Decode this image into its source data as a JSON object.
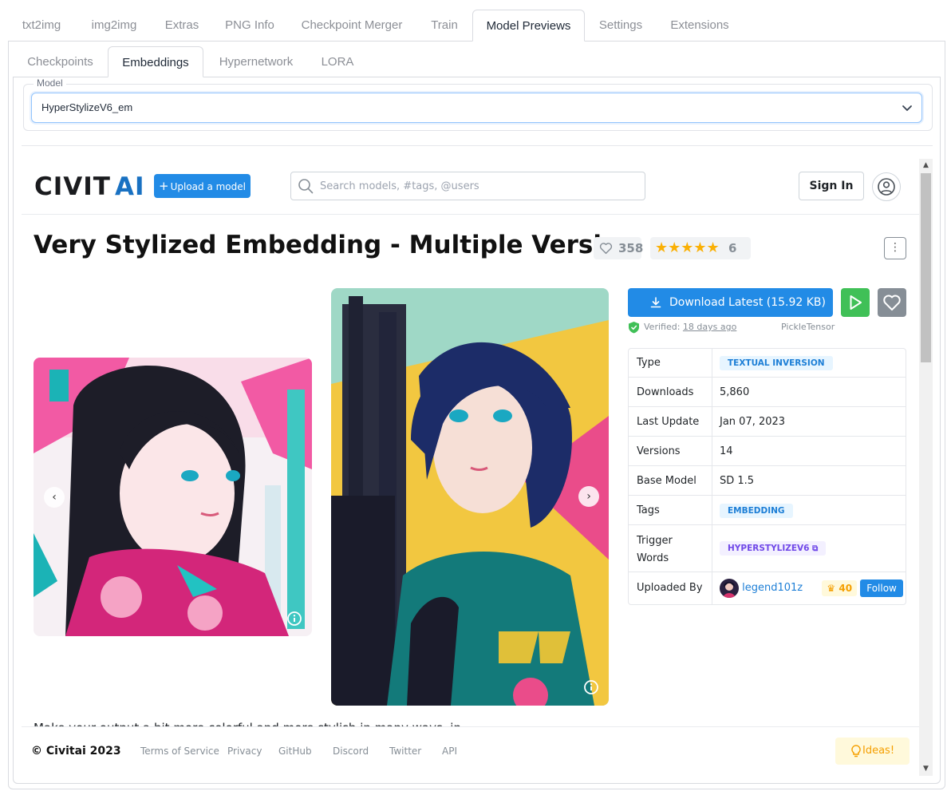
{
  "top_tabs": [
    {
      "label": "txt2img",
      "active": false
    },
    {
      "label": "img2img",
      "active": false
    },
    {
      "label": "Extras",
      "active": false
    },
    {
      "label": "PNG Info",
      "active": false
    },
    {
      "label": "Checkpoint Merger",
      "active": false
    },
    {
      "label": "Train",
      "active": false
    },
    {
      "label": "Model Previews",
      "active": true
    },
    {
      "label": "Settings",
      "active": false
    },
    {
      "label": "Extensions",
      "active": false
    }
  ],
  "sub_tabs": [
    {
      "label": "Checkpoints",
      "active": false
    },
    {
      "label": "Embeddings",
      "active": true
    },
    {
      "label": "Hypernetwork",
      "active": false
    },
    {
      "label": "LORA",
      "active": false
    }
  ],
  "model_field": {
    "label": "Model",
    "value": "HyperStylizeV6_em"
  },
  "civitai": {
    "logo_text": "CIVITAI",
    "upload_label": "Upload a model",
    "search_placeholder": "Search models, #tags, @users",
    "signin_label": "Sign In",
    "title": "Very Stylized Embedding - Multiple Version",
    "likes": "358",
    "rating_count": "6",
    "rating_stars": 5,
    "download_label": "Download Latest (15.92 KB)",
    "verified_label": "Verified:",
    "verified_when": "18 days ago",
    "verified_by": "PickleTensor",
    "details": {
      "type_label": "Type",
      "type_value": "TEXTUAL INVERSION",
      "downloads_label": "Downloads",
      "downloads_value": "5,860",
      "last_update_label": "Last Update",
      "last_update_value": "Jan 07, 2023",
      "versions_label": "Versions",
      "versions_value": "14",
      "base_model_label": "Base Model",
      "base_model_value": "SD 1.5",
      "tags_label": "Tags",
      "tags_value": "EMBEDDING",
      "trigger_label_1": "Trigger",
      "trigger_label_2": "Words",
      "trigger_value": "HYPERSTYLIZEV6",
      "uploaded_label": "Uploaded By",
      "uploader": "legend101z",
      "uploader_score": "40",
      "follow_label": "Follow"
    },
    "description_peek": "Make your output a bit more colorful and more stylish in many ways, in",
    "footer": {
      "copyright": "© Civitai 2023",
      "links": [
        "Terms of Service",
        "Privacy",
        "GitHub",
        "Discord",
        "Twitter",
        "API"
      ],
      "ideas_label": "Ideas!"
    }
  },
  "colors": {
    "accent": "#228be6",
    "play": "#40c057",
    "star": "#fab005",
    "logo_accent": "#1971c2"
  },
  "icons": [
    "chevron-down-icon",
    "search-icon",
    "user-icon",
    "heart-icon",
    "star-icon",
    "more-icon",
    "download-icon",
    "play-icon",
    "shield-check-icon",
    "info-icon",
    "chevron-left-icon",
    "chevron-right-icon",
    "copy-icon",
    "crown-icon",
    "bulb-icon"
  ]
}
